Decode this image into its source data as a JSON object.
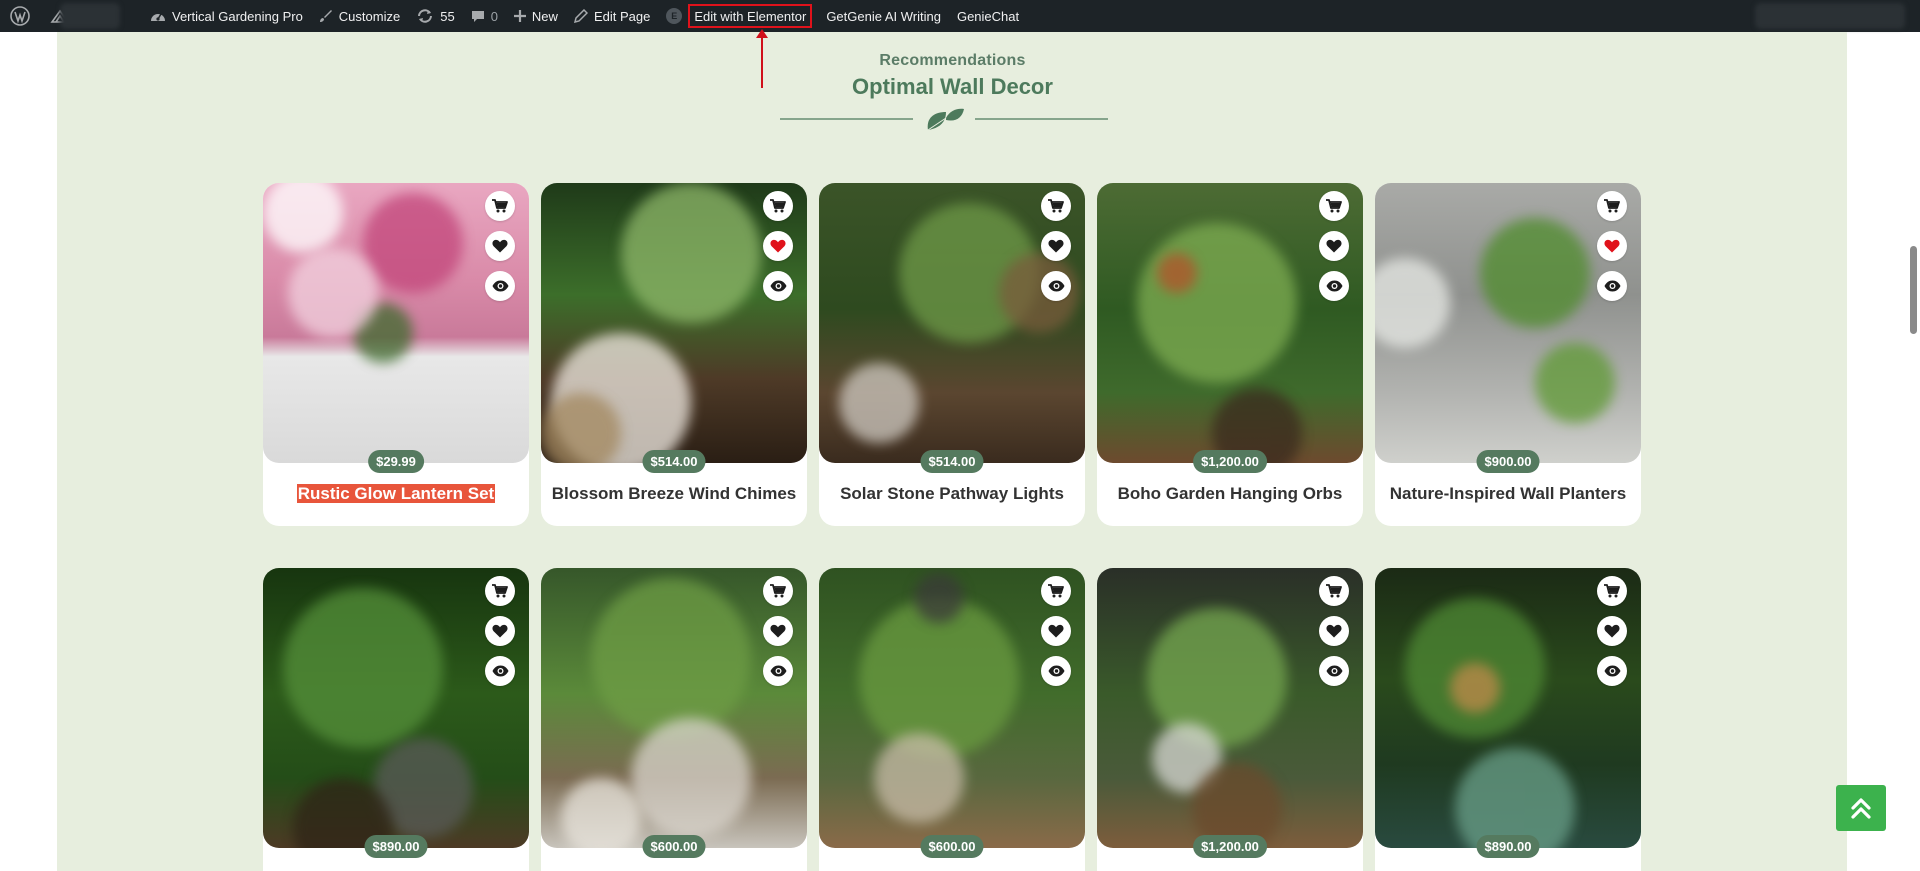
{
  "adminbar": {
    "site_name": "Vertical Gardening Pro",
    "customize": "Customize",
    "updates_count": "55",
    "comments_count": "0",
    "new": "New",
    "edit_page": "Edit Page",
    "elementor_badge": "E",
    "edit_elementor": "Edit with Elementor",
    "getgenie_writing": "GetGenie AI Writing",
    "geniechat": "GenieChat"
  },
  "section": {
    "subtitle": "Recommendations",
    "title": "Optimal Wall Decor"
  },
  "products": [
    {
      "name": "Rustic Glow Lantern Set",
      "price": "$29.99",
      "wishlisted": false,
      "selected": true
    },
    {
      "name": "Blossom Breeze Wind Chimes",
      "price": "$514.00",
      "wishlisted": true,
      "selected": false
    },
    {
      "name": "Solar Stone Pathway Lights",
      "price": "$514.00",
      "wishlisted": false,
      "selected": false
    },
    {
      "name": "Boho Garden Hanging Orbs",
      "price": "$1,200.00",
      "wishlisted": false,
      "selected": false
    },
    {
      "name": "Nature-Inspired Wall Planters",
      "price": "$900.00",
      "wishlisted": true,
      "selected": false
    },
    {
      "name": "",
      "price": "$890.00",
      "wishlisted": false,
      "selected": false
    },
    {
      "name": "",
      "price": "$600.00",
      "wishlisted": false,
      "selected": false
    },
    {
      "name": "",
      "price": "$600.00",
      "wishlisted": false,
      "selected": false
    },
    {
      "name": "",
      "price": "$1,200.00",
      "wishlisted": false,
      "selected": false
    },
    {
      "name": "",
      "price": "$890.00",
      "wishlisted": false,
      "selected": false
    }
  ],
  "icons": {
    "cart": "cart-icon",
    "wishlist": "heart-icon",
    "quick_view": "eye-icon",
    "back_to_top": "double-chevron-up-icon"
  },
  "colors": {
    "accent_green": "#557a5f",
    "section_bg": "#e7eede",
    "wishlist_active": "#e0121b",
    "selection_highlight": "#e8553b",
    "back_to_top": "#3cb24d"
  }
}
